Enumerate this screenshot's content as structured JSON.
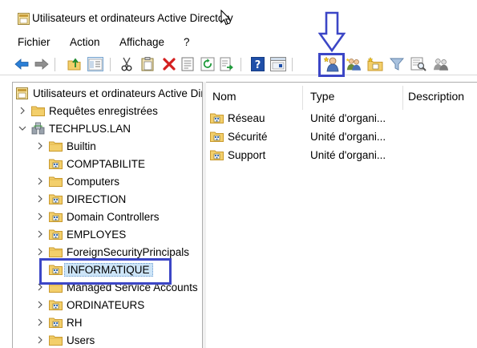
{
  "window": {
    "title": "Utilisateurs et ordinateurs Active Directory"
  },
  "menu": {
    "items": [
      "Fichier",
      "Action",
      "Affichage",
      "?"
    ]
  },
  "toolbar": {
    "icons": [
      "back-arrow-icon",
      "forward-arrow-icon",
      "folder-up-icon",
      "show-console-tree-icon",
      "cut-icon",
      "paste-icon",
      "delete-icon",
      "properties-icon",
      "refresh-icon",
      "export-list-icon",
      "help-icon",
      "console-icon",
      "new-user-icon",
      "new-group-icon",
      "new-ou-icon",
      "filter-icon",
      "find-icon",
      "add-to-group-icon"
    ]
  },
  "tree": {
    "root": "Utilisateurs et ordinateurs Active Directory",
    "saved_queries": "Requêtes enregistrées",
    "domain": "TECHPLUS.LAN",
    "children": [
      {
        "label": "Builtin",
        "expandable": true,
        "kind": "container"
      },
      {
        "label": "COMPTABILITE",
        "expandable": false,
        "kind": "ou"
      },
      {
        "label": "Computers",
        "expandable": true,
        "kind": "container"
      },
      {
        "label": "DIRECTION",
        "expandable": true,
        "kind": "ou"
      },
      {
        "label": "Domain Controllers",
        "expandable": true,
        "kind": "ou"
      },
      {
        "label": "EMPLOYES",
        "expandable": true,
        "kind": "ou"
      },
      {
        "label": "ForeignSecurityPrincipals",
        "expandable": true,
        "kind": "container"
      },
      {
        "label": "INFORMATIQUE",
        "expandable": false,
        "kind": "ou",
        "selected": true
      },
      {
        "label": "Managed Service Accounts",
        "expandable": true,
        "kind": "container"
      },
      {
        "label": "ORDINATEURS",
        "expandable": true,
        "kind": "ou"
      },
      {
        "label": "RH",
        "expandable": true,
        "kind": "ou"
      },
      {
        "label": "Users",
        "expandable": true,
        "kind": "container"
      }
    ]
  },
  "list": {
    "columns": [
      "Nom",
      "Type",
      "Description"
    ],
    "rows": [
      {
        "name": "Réseau",
        "type": "Unité d'organi..."
      },
      {
        "name": "Sécurité",
        "type": "Unité d'organi..."
      },
      {
        "name": "Support",
        "type": "Unité d'organi..."
      }
    ]
  },
  "colors": {
    "annotation": "#3c46c6",
    "folder": "#f3cf6b",
    "selection": "#cce4f7"
  }
}
